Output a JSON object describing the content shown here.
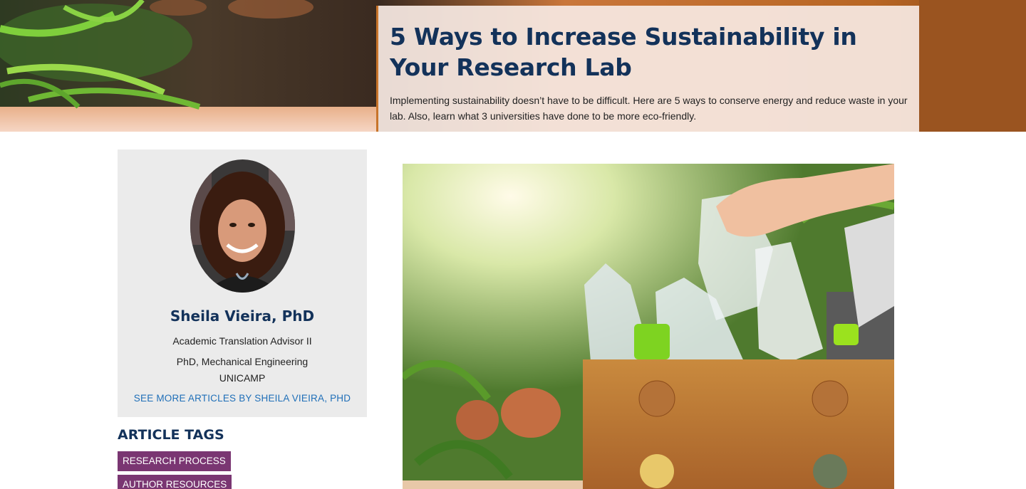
{
  "hero": {
    "title": "5 Ways to Increase Sustainability in Your Research Lab",
    "description": "Implementing sustainability doesn’t have to be difficult. Here are 5 ways to conserve energy and reduce waste in your lab. Also, learn what 3 universities have done to be more eco-friendly."
  },
  "author": {
    "name": "Sheila Vieira, PhD",
    "role": "Academic Translation Advisor II",
    "degree": "PhD, Mechanical Engineering",
    "school": "UNICAMP",
    "more_link": "SEE MORE ARTICLES BY SHEILA VIEIRA, PHD"
  },
  "tags": {
    "heading": "ARTICLE TAGS",
    "items": [
      "RESEARCH PROCESS",
      "AUTHOR RESOURCES"
    ]
  },
  "colors": {
    "title_navy": "#13325a",
    "tag_purple": "#7a3672",
    "link_blue": "#1f6fb8",
    "card_gray": "#ebebeb"
  }
}
